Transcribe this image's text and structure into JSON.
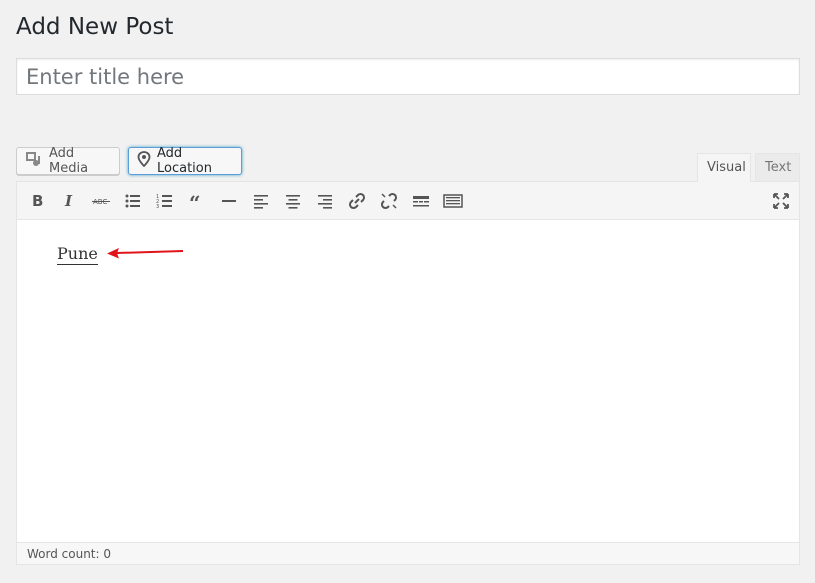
{
  "page": {
    "title": "Add New Post"
  },
  "title_field": {
    "placeholder": "Enter title here",
    "value": ""
  },
  "media_buttons": {
    "add_media": "Add Media",
    "add_location": "Add Location"
  },
  "tabs": {
    "visual": "Visual",
    "text": "Text"
  },
  "toolbar": {
    "items": [
      {
        "name": "bold-button",
        "icon": "bold-icon"
      },
      {
        "name": "italic-button",
        "icon": "italic-icon"
      },
      {
        "name": "strikethrough-button",
        "icon": "strikethrough-icon"
      },
      {
        "name": "bulleted-list-button",
        "icon": "bulleted-list-icon"
      },
      {
        "name": "numbered-list-button",
        "icon": "numbered-list-icon"
      },
      {
        "name": "blockquote-button",
        "icon": "blockquote-icon"
      },
      {
        "name": "horizontal-line-button",
        "icon": "horizontal-line-icon"
      },
      {
        "name": "align-left-button",
        "icon": "align-left-icon"
      },
      {
        "name": "align-center-button",
        "icon": "align-center-icon"
      },
      {
        "name": "align-right-button",
        "icon": "align-right-icon"
      },
      {
        "name": "insert-link-button",
        "icon": "link-icon"
      },
      {
        "name": "remove-link-button",
        "icon": "unlink-icon"
      },
      {
        "name": "read-more-button",
        "icon": "read-more-icon"
      },
      {
        "name": "toolbar-toggle-button",
        "icon": "keyboard-icon"
      },
      {
        "name": "fullscreen-button",
        "icon": "fullscreen-icon"
      }
    ]
  },
  "editor": {
    "content": "Pune",
    "word_count": "Word count: 0"
  },
  "colors": {
    "annotation_arrow": "#e0141b",
    "focus_border": "#5b9dd9"
  }
}
